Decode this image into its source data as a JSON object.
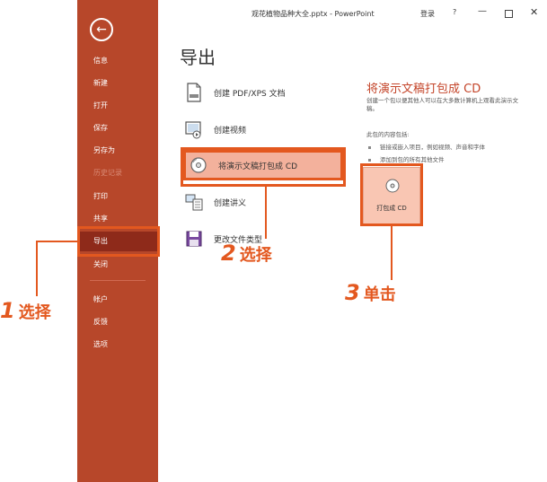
{
  "window": {
    "title": "观花植物品种大全.pptx  -  PowerPoint",
    "login": "登录",
    "help": "?",
    "minimize": "—",
    "close": "✕"
  },
  "sidebar": {
    "back_icon": "←",
    "items": [
      {
        "label": "信息"
      },
      {
        "label": "新建"
      },
      {
        "label": "打开"
      },
      {
        "label": "保存"
      },
      {
        "label": "另存为"
      },
      {
        "label": "历史记录"
      },
      {
        "label": "打印"
      },
      {
        "label": "共享"
      },
      {
        "label": "导出"
      },
      {
        "label": "关闭"
      },
      {
        "label": "帐户"
      },
      {
        "label": "反馈"
      },
      {
        "label": "选项"
      }
    ]
  },
  "main": {
    "title": "导出",
    "export_options": [
      {
        "label": "创建 PDF/XPS 文档",
        "icon": "pdf-document-icon"
      },
      {
        "label": "创建视频",
        "icon": "video-icon"
      },
      {
        "label": "将演示文稿打包成 CD",
        "icon": "cd-icon"
      },
      {
        "label": "创建讲义",
        "icon": "handout-icon"
      },
      {
        "label": "更改文件类型",
        "icon": "save-disk-icon"
      }
    ]
  },
  "panel": {
    "title": "将演示文稿打包成 CD",
    "description": "创建一个包以便其他人可以在大多数计算机上观看此演示文稿。",
    "includes_label": "此包的内容包括:",
    "bullets": [
      "链接或嵌入项目，例如视频、声音和字体",
      "添加到包的所有其他文件"
    ],
    "button_label": "打包成 CD"
  },
  "callouts": {
    "c1": {
      "num": "1",
      "text": "选择"
    },
    "c2": {
      "num": "2",
      "text": "选择"
    },
    "c3": {
      "num": "3",
      "text": "单击"
    }
  },
  "colors": {
    "sidebar": "#b7472a",
    "accent": "#e3581f"
  }
}
